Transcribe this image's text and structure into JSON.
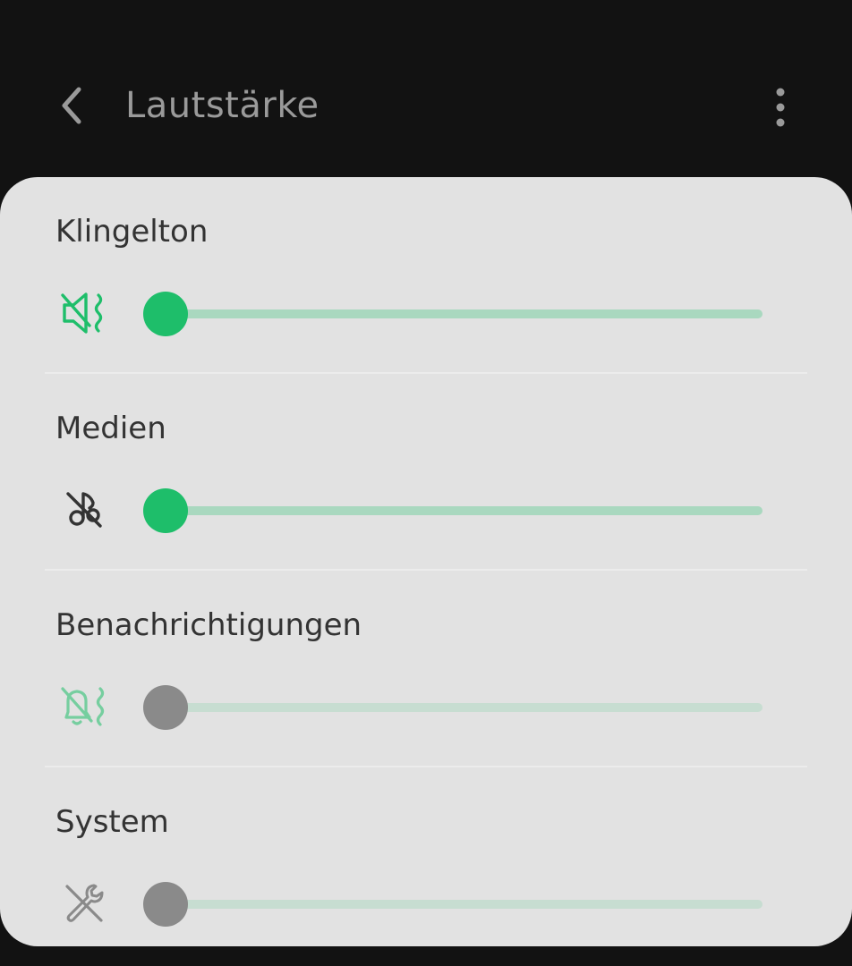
{
  "header": {
    "title": "Lautstärke",
    "back_icon": "chevron-left-icon",
    "menu_icon": "more-vertical-icon"
  },
  "colors": {
    "background": "#121212",
    "card": "#e2e2e2",
    "accent": "#1ebe6a",
    "track": "#a9d8bf",
    "thumb_disabled": "#8a8a8a",
    "icon_green": "#1ebe6a",
    "icon_dark": "#333333",
    "icon_gray": "#8a8a8a"
  },
  "volume_sections": [
    {
      "label": "Klingelton",
      "icon": "vibrate-speaker-icon",
      "value": 0,
      "enabled": true
    },
    {
      "label": "Medien",
      "icon": "music-note-off-icon",
      "value": 0,
      "enabled": true
    },
    {
      "label": "Benachrichtigungen",
      "icon": "bell-off-vibrate-icon",
      "value": 0,
      "enabled": false
    },
    {
      "label": "System",
      "icon": "wrench-off-icon",
      "value": 0,
      "enabled": false
    }
  ]
}
